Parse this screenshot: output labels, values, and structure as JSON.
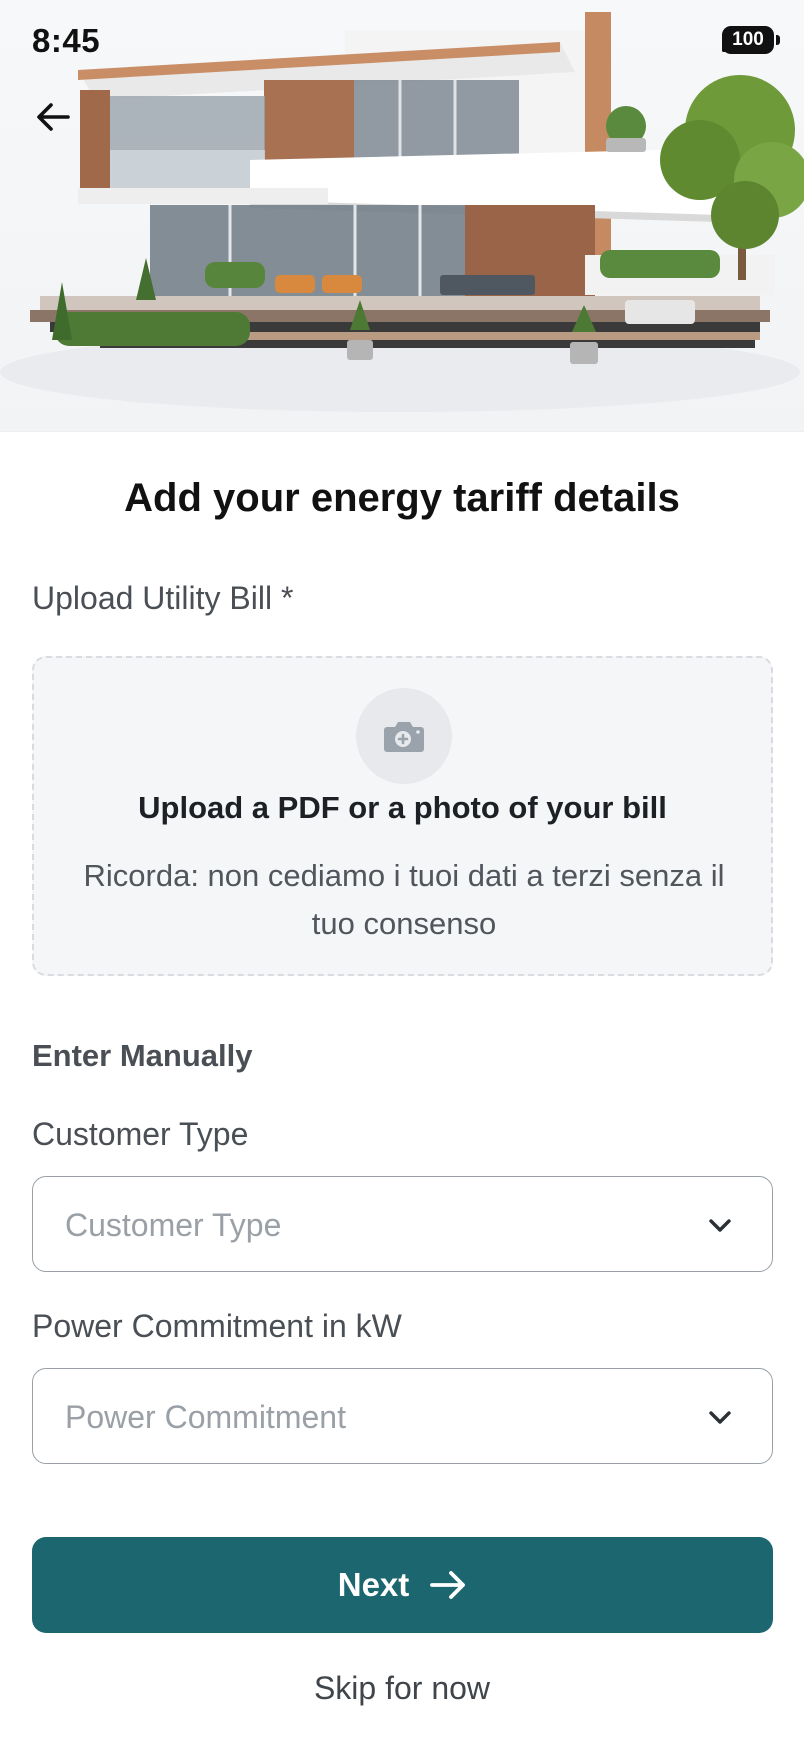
{
  "status_bar": {
    "time": "8:45",
    "battery": "100",
    "icons": [
      "signal-icon",
      "wifi-icon",
      "battery-icon"
    ]
  },
  "hero": {
    "image": "modern-house-illustration"
  },
  "header": {
    "back_icon": "arrow-left-icon",
    "title": "Add your energy tariff details"
  },
  "upload": {
    "label": "Upload Utility Bill *",
    "icon": "camera-plus-icon",
    "title": "Upload a PDF or a photo of your bill",
    "note": "Ricorda: non cediamo i tuoi dati a terzi senza il tuo consenso"
  },
  "manual": {
    "heading": "Enter Manually",
    "customer_type": {
      "label": "Customer Type",
      "placeholder": "Customer Type"
    },
    "power_commitment": {
      "label": "Power Commitment in kW",
      "placeholder": "Power Commitment"
    }
  },
  "actions": {
    "next_label": "Next",
    "next_icon": "arrow-right-icon",
    "skip_label": "Skip for now"
  },
  "colors": {
    "primary": "#1c6670",
    "upload_bg": "#f5f6f8",
    "placeholder": "#9aa0a6"
  }
}
